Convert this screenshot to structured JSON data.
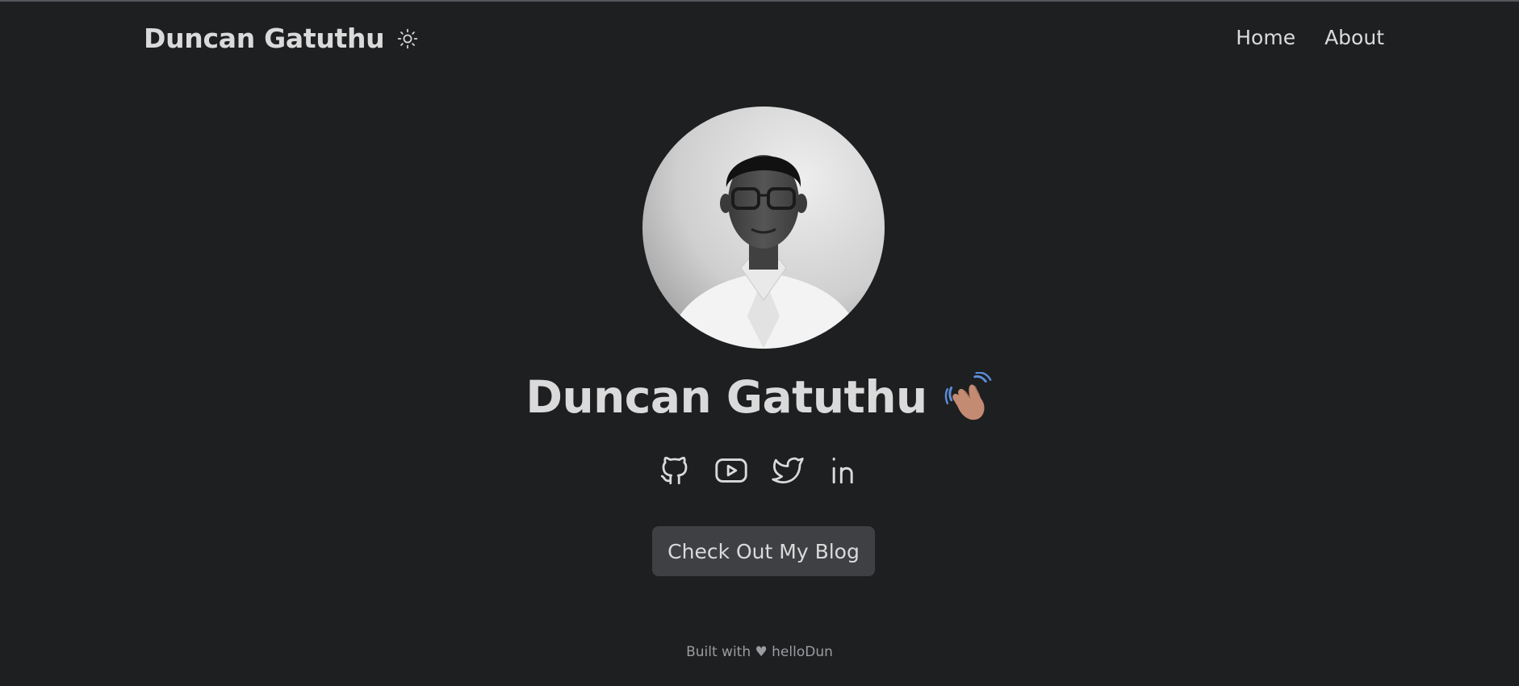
{
  "header": {
    "site_title": "Duncan Gatuthu",
    "theme_toggle_icon": "sun-icon",
    "nav": [
      {
        "label": "Home"
      },
      {
        "label": "About"
      }
    ]
  },
  "profile": {
    "avatar": "profile-photo",
    "name": "Duncan Gatuthu",
    "greeting_icon": "waving-hand-icon"
  },
  "socials": [
    {
      "icon": "github-icon"
    },
    {
      "icon": "youtube-icon"
    },
    {
      "icon": "twitter-icon"
    },
    {
      "icon": "linkedin-icon"
    }
  ],
  "cta": {
    "label": "Check Out My Blog"
  },
  "footer": {
    "text": "Built with ♥ helloDun"
  },
  "colors": {
    "background": "#1e1f21",
    "text": "#dadadb",
    "button": "#3f4043",
    "footer_text": "#9b9c9f"
  }
}
